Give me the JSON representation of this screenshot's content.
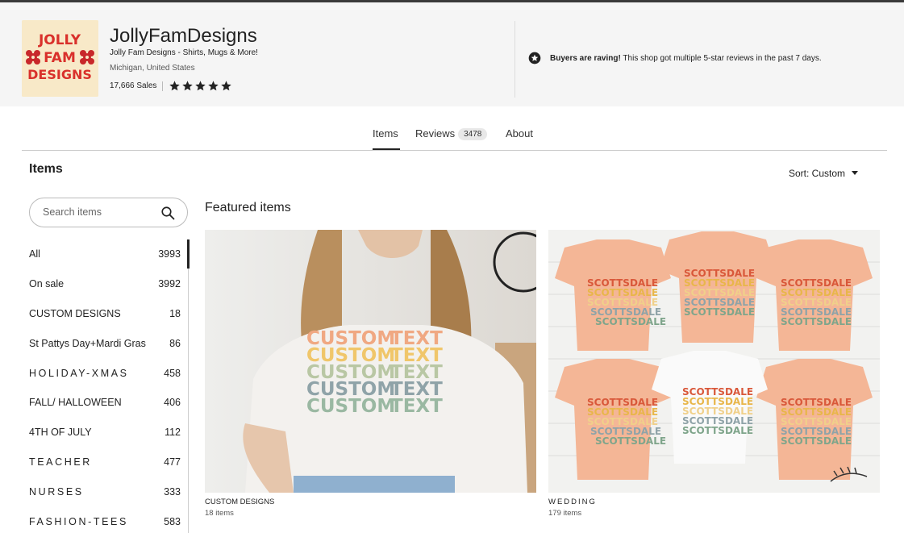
{
  "shop": {
    "logo_text": "JOLLY FAM DESIGNS",
    "name": "JollyFamDesigns",
    "tagline": "Jolly Fam Designs - Shirts, Mugs & More!",
    "location": "Michigan, United States",
    "sales": "17,666 Sales",
    "rating": 5,
    "rave_bold": "Buyers are raving!",
    "rave_text": " This shop got multiple 5-star reviews in the past 7 days."
  },
  "tabs": {
    "items": "Items",
    "reviews": "Reviews",
    "reviews_count": "3478",
    "about": "About"
  },
  "items_section": {
    "title": "Items",
    "sort_label": "Sort: Custom",
    "search_placeholder": "Search items",
    "featured_title": "Featured items"
  },
  "categories": [
    {
      "label": "All",
      "count": "3993"
    },
    {
      "label": "On sale",
      "count": "3992"
    },
    {
      "label": "CUSTOM DESIGNS",
      "count": "18"
    },
    {
      "label": "St Pattys Day+Mardi Gras",
      "count": "86"
    },
    {
      "label": "HOLIDAY-XMAS",
      "count": "458"
    },
    {
      "label": "FALL/ HALLOWEEN",
      "count": "406"
    },
    {
      "label": "4TH OF JULY",
      "count": "112"
    },
    {
      "label": "TEACHER",
      "count": "477"
    },
    {
      "label": "NURSES",
      "count": "333"
    },
    {
      "label": "FASHION-TEES",
      "count": "583"
    }
  ],
  "featured": [
    {
      "title": "CUSTOM DESIGNS",
      "count": "18 items",
      "shirt_text": "CUSTOM TEXT"
    },
    {
      "title": "WEDDING",
      "count": "179 items",
      "shirt_text": "SCOTTSDALE"
    }
  ],
  "colors": {
    "header_bg": "#f5f5f5",
    "logo_red": "#d9302b",
    "peach": "#f4b696",
    "text_palette": [
      "#f0a882",
      "#f0c66a",
      "#b9c7a4",
      "#8fa3a8",
      "#9ab8a2"
    ]
  }
}
